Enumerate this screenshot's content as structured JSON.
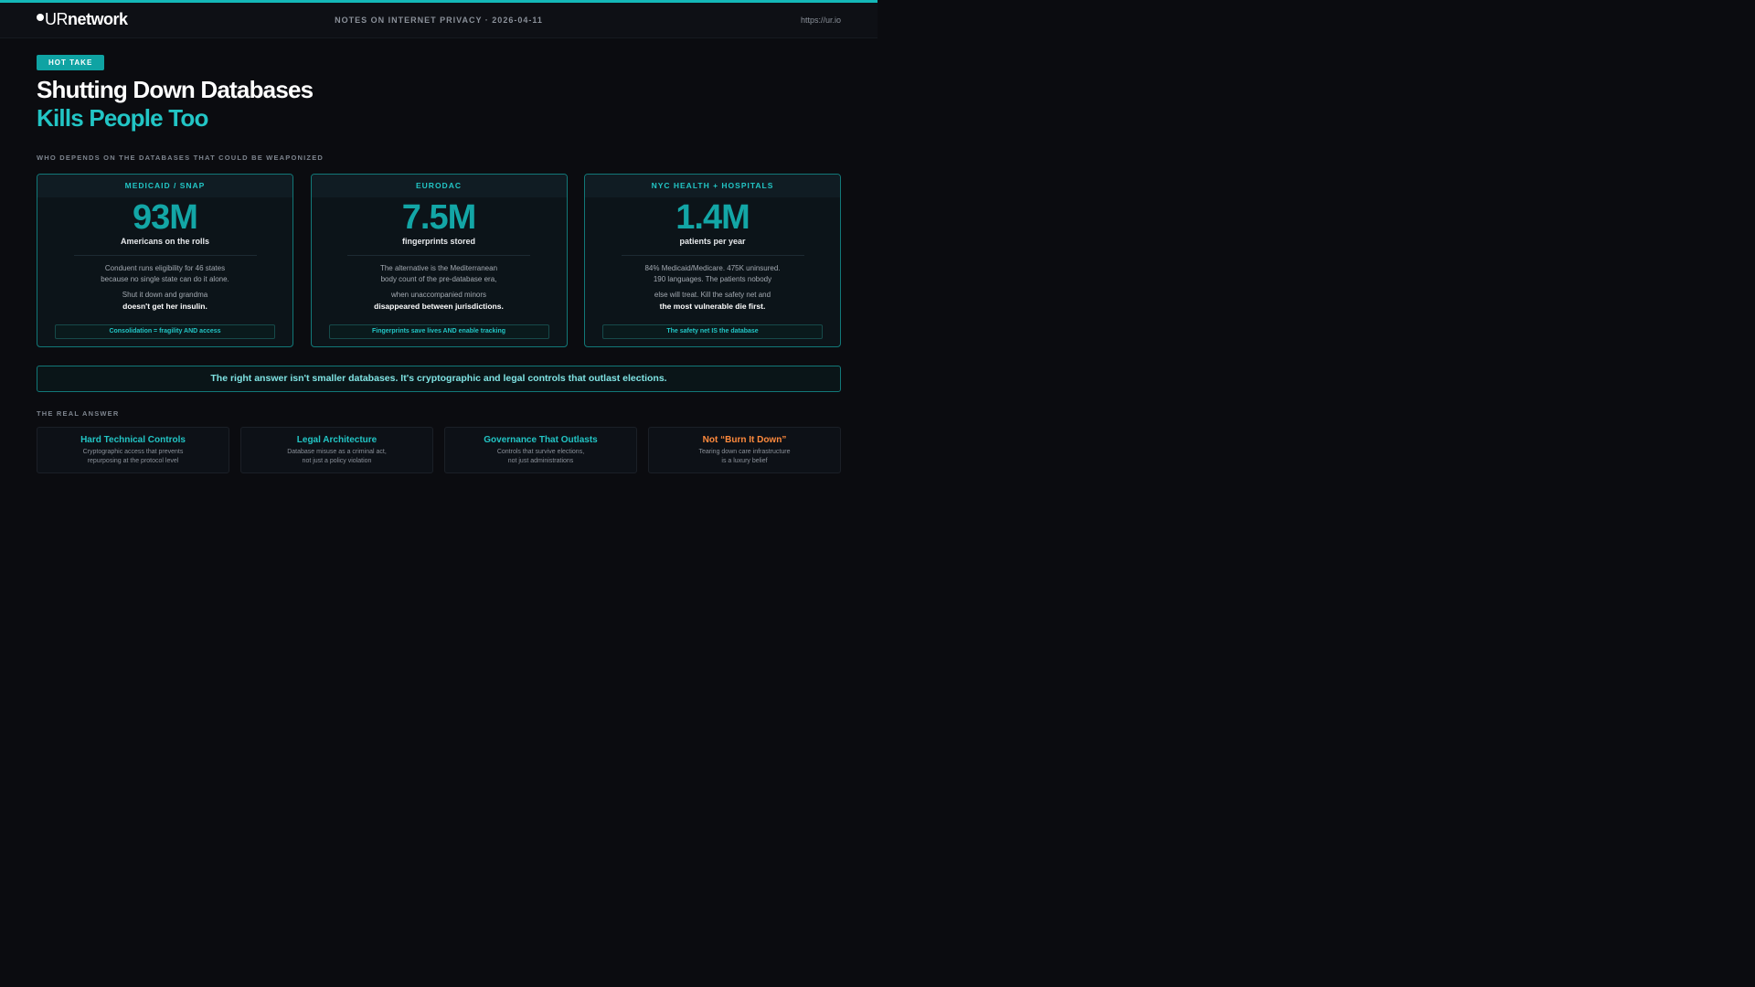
{
  "header": {
    "logo_ur": "UR",
    "logo_network": "network",
    "center": "NOTES ON INTERNET PRIVACY  ·  2026-04-11",
    "url": "https://ur.io"
  },
  "badge": "HOT TAKE",
  "title": {
    "line1": "Shutting Down Databases",
    "line2": "Kills People Too"
  },
  "section1_label": "WHO DEPENDS ON THE DATABASES THAT COULD BE WEAPONIZED",
  "cards": [
    {
      "head": "MEDICAID / SNAP",
      "big": "93M",
      "unit": "Americans on the rolls",
      "body1a": "Conduent runs eligibility for 46 states",
      "body1b": "because no single state can do it alone.",
      "body2a": "Shut it down and grandma",
      "body2b": "doesn't get her insulin.",
      "foot": "Consolidation = fragility AND access"
    },
    {
      "head": "EURODAC",
      "big": "7.5M",
      "unit": "fingerprints stored",
      "body1a": "The alternative is the Mediterranean",
      "body1b": "body count of the pre-database era,",
      "body2a": "when unaccompanied minors",
      "body2b": "disappeared between jurisdictions.",
      "foot": "Fingerprints save lives AND enable tracking"
    },
    {
      "head": "NYC HEALTH + HOSPITALS",
      "big": "1.4M",
      "unit": "patients per year",
      "body1a": "84% Medicaid/Medicare. 475K uninsured.",
      "body1b": "190 languages. The patients nobody",
      "body2a": "else will treat. Kill the safety net and",
      "body2b": "the most vulnerable die first.",
      "foot": "The safety net IS the database"
    }
  ],
  "banner": "The right answer isn't smaller databases. It's cryptographic and legal controls that outlast elections.",
  "section2_label": "THE REAL ANSWER",
  "answers": [
    {
      "title": "Hard Technical Controls",
      "desc1": "Cryptographic access that prevents",
      "desc2": "repurposing at the protocol level"
    },
    {
      "title": "Legal Architecture",
      "desc1": "Database misuse as a criminal act,",
      "desc2": "not just a policy violation"
    },
    {
      "title": "Governance That Outlasts",
      "desc1": "Controls that survive elections,",
      "desc2": "not just administrations"
    },
    {
      "title": "Not “Burn It Down”",
      "desc1": "Tearing down care infrastructure",
      "desc2": "is a luxury belief"
    }
  ],
  "colors": {
    "accent": "#22c5c5",
    "accent_dark": "#13a6a6",
    "warning": "#ff8a3d",
    "background": "#0b0c10"
  }
}
